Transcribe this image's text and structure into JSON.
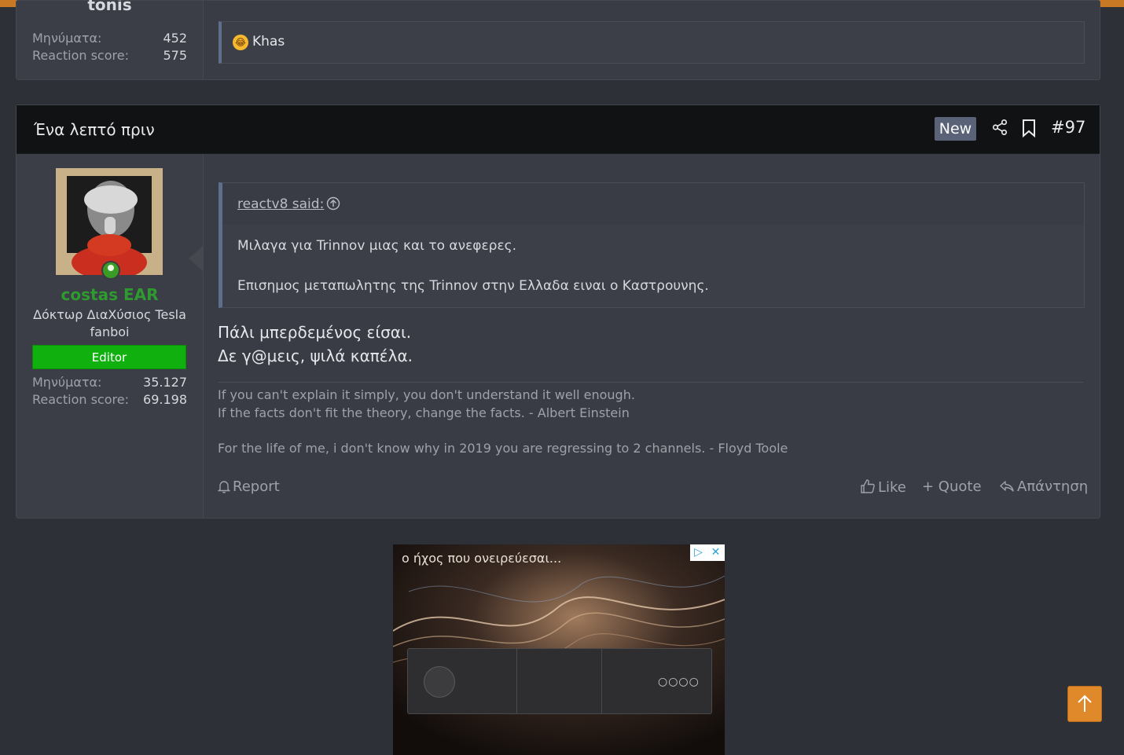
{
  "post_prev": {
    "username": "tonis",
    "messages_label": "Μηνύματα:",
    "messages_value": "452",
    "reaction_label": "Reaction score:",
    "reaction_value": "575",
    "reaction_user": "Khas"
  },
  "post": {
    "time": "Ένα λεπτό πριν",
    "new_badge": "New",
    "number": "#97",
    "username": "costas EAR",
    "user_title": "Δόκτωρ ΔιαΧύσιος Tesla fanboi",
    "role_badge": "Editor",
    "messages_label": "Μηνύματα:",
    "messages_value": "35.127",
    "reaction_label": "Reaction score:",
    "reaction_value": "69.198",
    "quote": {
      "author": "reactv8 said:",
      "line1": "Μιλαγα για Trinnov μιας και το ανεφερες.",
      "line2": "Επισημος μεταπωλητης της Trinnov στην Ελλαδα ειναι ο Καστρουνης."
    },
    "body": {
      "line1": "Πάλι μπερδεμένος είσαι.",
      "line2": "Δε γ@μεις, ψιλά καπέλα."
    },
    "signature": {
      "line1": "If you can't explain it simply, you don't understand it well enough.",
      "line2": "If the facts don't fit the theory, change the facts. - Albert Einstein",
      "line3": "For the life of me, i don't know why in 2019 you are regressing to 2 channels. - Floyd Toole"
    },
    "actions": {
      "report": "Report",
      "like": "Like",
      "quote": "+ Quote",
      "reply": "Απάντηση"
    }
  },
  "ad": {
    "text": "ο ήχος που ονειρεύεσαι..."
  },
  "colors": {
    "accent": "#c77a23",
    "editor_badge": "#10b10f",
    "username_green": "#2f9a2f",
    "new_badge": "#5a6277"
  }
}
